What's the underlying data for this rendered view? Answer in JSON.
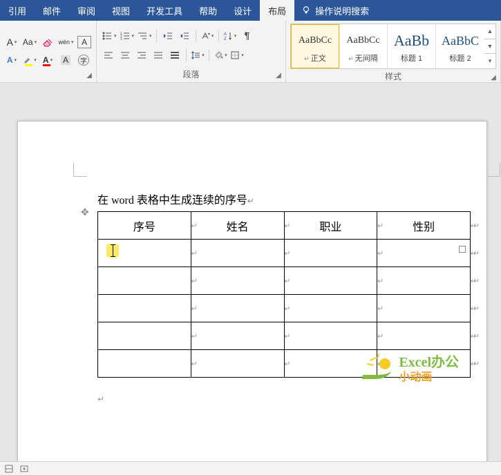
{
  "menu": {
    "tabs": [
      "引用",
      "邮件",
      "审阅",
      "视图",
      "开发工具",
      "帮助",
      "设计",
      "布局"
    ],
    "active_index": 7,
    "context_indices": [
      6,
      7
    ],
    "tellme": "操作说明搜索"
  },
  "ribbon": {
    "font": {
      "label": "",
      "A_upper": "A",
      "a_lower": "a",
      "Aa": "Aa",
      "wen": "wén",
      "box_A": "A",
      "A_super": "A",
      "highlight_color": "#ffff00",
      "font_color": "#ff0000",
      "A_font": "A",
      "border_A": "A"
    },
    "paragraph": {
      "label": "段落"
    },
    "styles": {
      "label": "样式",
      "items": [
        {
          "preview": "AaBbCc",
          "name": "正文",
          "tick": true,
          "selected": true,
          "big": false
        },
        {
          "preview": "AaBbCc",
          "name": "无间隔",
          "tick": true,
          "selected": false,
          "big": false
        },
        {
          "preview": "AaBb",
          "name": "标题 1",
          "tick": false,
          "selected": false,
          "big": true
        },
        {
          "preview": "AaBbC",
          "name": "标题 2",
          "tick": false,
          "selected": false,
          "big": true
        }
      ]
    }
  },
  "document": {
    "title_text": "在 word 表格中生成连续的序号",
    "columns": [
      "序号",
      "姓名",
      "职业",
      "性别"
    ],
    "body_rows": 5,
    "caret_cell": {
      "row": 0,
      "col": 0
    }
  },
  "watermark": {
    "line1": "Excel办公",
    "line2": "小动画"
  }
}
